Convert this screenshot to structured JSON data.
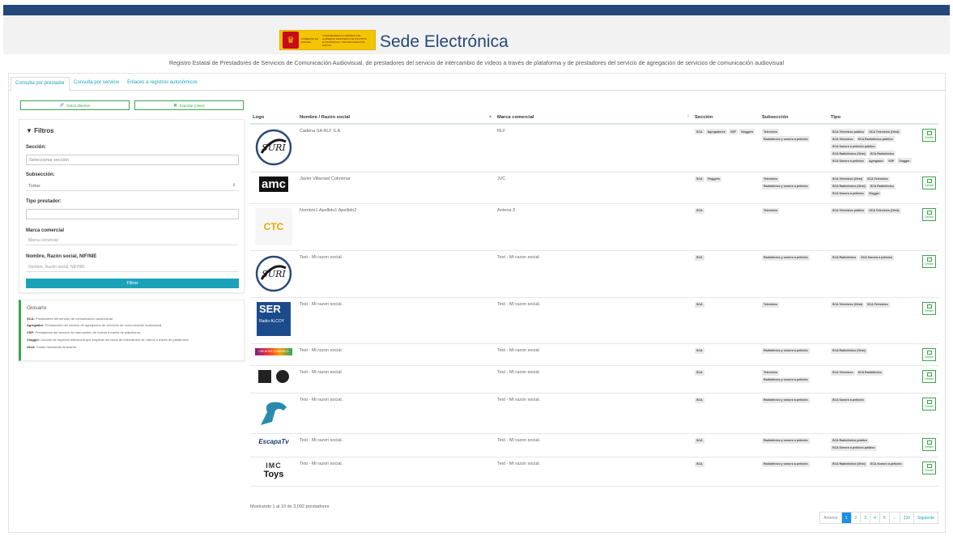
{
  "header": {
    "title": "Sede Electrónica",
    "logo_left": "GOBIERNO DE ESPAÑA",
    "logo_right": "VICEPRESIDENCIA PRIMERA DEL GOBIERNO MINISTERIO DE ASUNTOS ECONÓMICOS Y TRANSFORMACIÓN DIGITAL",
    "subtitle": "Registro Estatal de Prestadores de Servicios de Comunicación Audiovisual, de prestadores del servicio de intercambio de vídeos a través de plataforma y de prestadores del servicio de agregación de servicios de comunicación audiovisual"
  },
  "tabs": [
    {
      "label": "Consulta por prestador"
    },
    {
      "label": "Consulta por servicio"
    },
    {
      "label": "Enlaces a registros autonómicos"
    }
  ],
  "actions": {
    "open_data": "Datos abiertos",
    "export": "Exportar (clear)"
  },
  "filters": {
    "title": "Filtros",
    "seccion_label": "Sección:",
    "seccion_placeholder": "Seleccionar sección",
    "subseccion_label": "Subsección:",
    "subseccion_value": "Todas",
    "tipo_label": "Tipo prestador:",
    "marca_label": "Marca comercial",
    "marca_placeholder": "Marca comercial",
    "nombre_label": "Nombre, Razón social, NIF/NIE",
    "nombre_placeholder": "Nombre, Razón social, NIF/NIE",
    "filter_button": "Filtrar"
  },
  "glossary": {
    "title": "Glosario",
    "items": [
      {
        "term": "SCA:",
        "text": "Prestadores del servicio de comunicación audiovisual."
      },
      {
        "term": "Agregador:",
        "text": "Prestadores del servicio de agregación de servicios de comunicación audiovisual."
      },
      {
        "term": "VSP:",
        "text": "Prestadores del servicio de intercambio de vídeos a través de plataforma."
      },
      {
        "term": "Vlogger:",
        "text": "Usuario de especial relevancia que emplean servicios de intercambio de vídeos a través de plataforma."
      },
      {
        "term": "Ohst:",
        "text": "Ondas hertzianas terrestres."
      }
    ]
  },
  "table": {
    "columns": [
      "Logo",
      "Nombre / Razón social",
      "Marca comercial",
      "Sección",
      "Subsección",
      "Tipo"
    ],
    "detail_label": "Detalle",
    "rows": [
      {
        "logo": "SURI",
        "nombre": "Cadena SA RLF S.A.",
        "marca": "RLF",
        "seccion": [
          "SCA",
          "Agregadores",
          "VSP",
          "Vloggers"
        ],
        "subseccion": [
          "Televisivo",
          "Radiofónico y sonoro a petición"
        ],
        "tipo": [
          "SCA Televisivo público",
          "SCA Televisivo (Ohst)",
          "SCA Televisivo",
          "SCA Radiofónico público",
          "SCA Sonoro a petición público",
          "SCA Radiofónico (Ohst)",
          "SCA Radiofónico",
          "SCA Sonoro a petición",
          "Agregador",
          "VSP",
          "Vlogger"
        ]
      },
      {
        "logo": "AMC",
        "nombre": "Javier Villarrael Colmenar",
        "marca": "JVC",
        "seccion": [
          "SCA",
          "Vloggers"
        ],
        "subseccion": [
          "Televisivo",
          "Radiofónico y sonoro a petición"
        ],
        "tipo": [
          "SCA Televisivo (Ohst)",
          "SCA Televisivo",
          "SCA Radiofónico (Ohst)",
          "SCA Radiofónico",
          "SCA Sonoro a petición",
          "Vlogger"
        ]
      },
      {
        "logo": "CTC",
        "nombre": "Nombre1 Apellido1 Apellido2",
        "marca": "Antena 3",
        "seccion": [
          "SCA"
        ],
        "subseccion": [
          "Televisivo"
        ],
        "tipo": [
          "SCA Televisivo público",
          "SCA Televisivo (Ohst)"
        ]
      },
      {
        "logo": "SURI",
        "nombre": "Test - Mi razon social.",
        "marca": "Test - Mi razon social.",
        "seccion": [
          "SCA"
        ],
        "subseccion": [
          "Radiofónico y sonoro a petición"
        ],
        "tipo": [
          "SCA Radiofónico",
          "SCA Sonoro a petición"
        ]
      },
      {
        "logo": "SER",
        "nombre": "Test - Mi razon social.",
        "marca": "Test - Mi razon social.",
        "seccion": [
          "SCA"
        ],
        "subseccion": [
          "Televisivo"
        ],
        "tipo": [
          "SCA Televisivo (Ohst)",
          "SCA Televisivo"
        ]
      },
      {
        "logo": "CREATIVE CHANNELS",
        "nombre": "Test - Mi razon social.",
        "marca": "Test - Mi razon social.",
        "seccion": [
          "SCA"
        ],
        "subseccion": [
          "Radiofónico y sonoro a petición"
        ],
        "tipo": [
          "SCA Radiofónico (Ohst)"
        ]
      },
      {
        "logo": "EYES",
        "nombre": "Test - Mi razon social.",
        "marca": "Test - Mi razon social.",
        "seccion": [
          "SCA"
        ],
        "subseccion": [
          "Televisivo",
          "Radiofónico y sonoro a petición"
        ],
        "tipo": [
          "SCA Televisivo",
          "SCA Radiofónico"
        ]
      },
      {
        "logo": "BULL",
        "nombre": "Test - Mi razon social.",
        "marca": "Test - Mi razon social.",
        "seccion": [
          "SCA"
        ],
        "subseccion": [
          "Radiofónico y sonoro a petición"
        ],
        "tipo": [
          "SCA Sonoro a petición"
        ]
      },
      {
        "logo": "EscapaTV",
        "nombre": "Test - Mi razon social.",
        "marca": "Test - Mi razon social.",
        "seccion": [
          "SCA"
        ],
        "subseccion": [
          "Radiofónico y sonoro a petición"
        ],
        "tipo": [
          "SCA Radiofónico público",
          "SCA Sonoro a petición público"
        ]
      },
      {
        "logo": "IMC Toys",
        "nombre": "Test - Mi razon social.",
        "marca": "Test - Mi razon social.",
        "seccion": [
          "SCA"
        ],
        "subseccion": [
          "Radiofónico y sonoro a petición"
        ],
        "tipo": [
          "SCA Radiofónico (Ohst)",
          "SCA Sonoro a petición"
        ]
      }
    ]
  },
  "footer": {
    "showing": "Mostrando 1 al 10 de 3,092 prestadores"
  },
  "pagination": [
    "Anterior",
    "1",
    "2",
    "3",
    "4",
    "5",
    "...",
    "310",
    "Siguiente"
  ],
  "colors": {
    "topbar": "#25487a",
    "accent": "#1aa3b8",
    "green": "#3aa64a",
    "active_page": "#1a8fe3"
  }
}
